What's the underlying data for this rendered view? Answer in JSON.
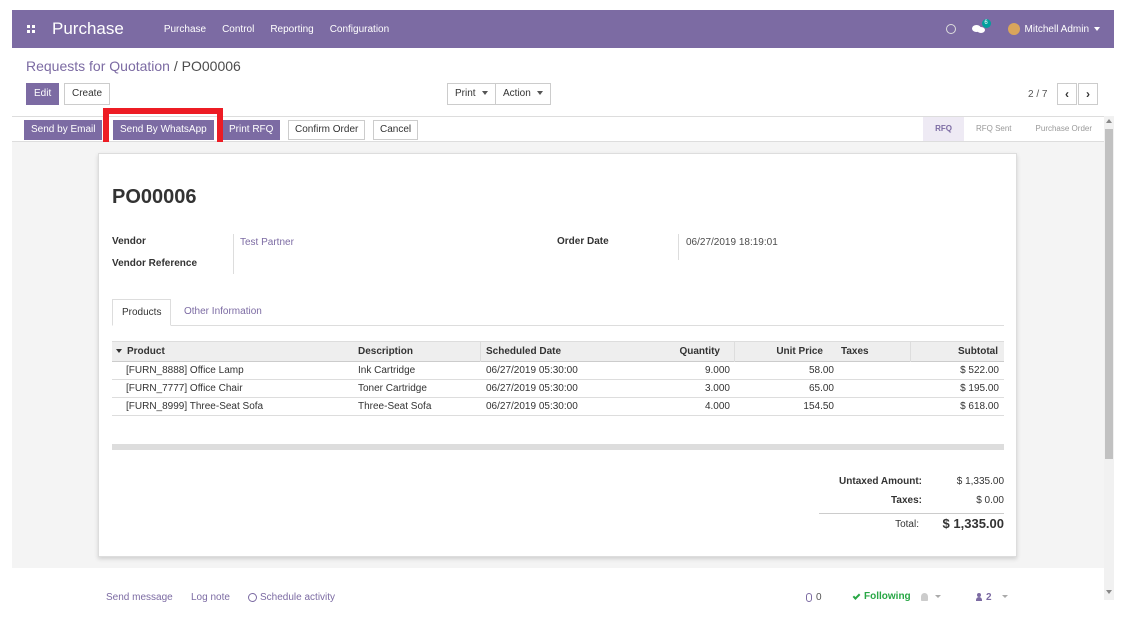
{
  "navbar": {
    "brand": "Purchase",
    "menu": [
      "Purchase",
      "Control",
      "Reporting",
      "Configuration"
    ],
    "chat_count": "6",
    "user": "Mitchell Admin"
  },
  "breadcrumb": {
    "parent": "Requests for Quotation",
    "separator": " / ",
    "current": "PO00006"
  },
  "control": {
    "edit": "Edit",
    "create": "Create",
    "print": "Print",
    "action": "Action",
    "pager": "2 / 7",
    "prev": "‹",
    "next": "›"
  },
  "statusbar": {
    "buttons": [
      "Send by Email",
      "Send By WhatsApp",
      "Print RFQ",
      "Confirm Order",
      "Cancel"
    ],
    "stages": [
      "RFQ",
      "RFQ Sent",
      "Purchase Order"
    ],
    "active_stage": "RFQ"
  },
  "form": {
    "title": "PO00006",
    "vendor_label": "Vendor",
    "vendor": "Test Partner",
    "vendor_ref_label": "Vendor Reference",
    "order_date_label": "Order Date",
    "order_date": "06/27/2019 18:19:01"
  },
  "tabs": [
    "Products",
    "Other Information"
  ],
  "table": {
    "headers": [
      "Product",
      "Description",
      "Scheduled Date",
      "Quantity",
      "Unit Price",
      "Taxes",
      "Subtotal"
    ],
    "rows": [
      [
        "[FURN_8888] Office Lamp",
        "Ink Cartridge",
        "06/27/2019 05:30:00",
        "9.000",
        "58.00",
        "",
        "$ 522.00"
      ],
      [
        "[FURN_7777] Office Chair",
        "Toner Cartridge",
        "06/27/2019 05:30:00",
        "3.000",
        "65.00",
        "",
        "$ 195.00"
      ],
      [
        "[FURN_8999] Three-Seat Sofa",
        "Three-Seat Sofa",
        "06/27/2019 05:30:00",
        "4.000",
        "154.50",
        "",
        "$ 618.00"
      ]
    ]
  },
  "totals": {
    "untaxed_label": "Untaxed Amount:",
    "untaxed": "$ 1,335.00",
    "taxes_label": "Taxes:",
    "taxes": "$ 0.00",
    "total_label": "Total:",
    "total": "$ 1,335.00"
  },
  "chatter": {
    "send_message": "Send message",
    "log_note": "Log note",
    "schedule": "Schedule activity",
    "attachments": "0",
    "following": "Following",
    "followers": "2"
  },
  "colors": {
    "brand": "#7c6ba3",
    "highlight": "#ed1c24",
    "success": "#28a745"
  }
}
